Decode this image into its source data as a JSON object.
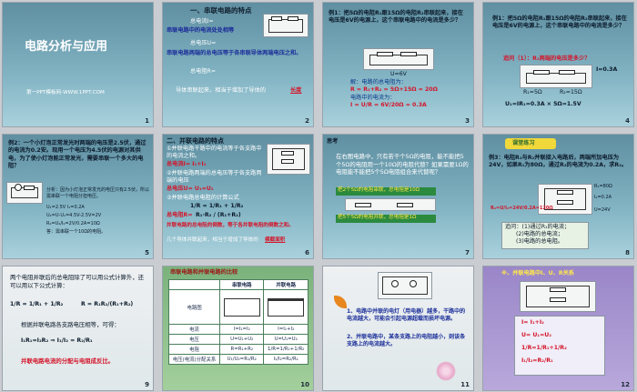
{
  "slides": [
    {
      "num": "1",
      "title": "电路分析与应用",
      "footer": "第一PPT模板网-WWW.1PPT.COM"
    },
    {
      "num": "2",
      "heading": "一、串联电路的特点",
      "l1": "总电流I=",
      "l2": "串联电路中的电流处处相等",
      "l3": "总电压U=",
      "l4": "串联电路两端的总电压等于各串联导体两端电压之和。",
      "l5": "总电阻R=",
      "l6": "导体串联起来，相当于增加了导体的",
      "l6b": "长度"
    },
    {
      "num": "3",
      "q": "例1：把5Ω的电阻R₁跟15Ω的电阻R₂串联起来，接在电压是6V的电源上，这个串联电路中的电流是多少？",
      "v": "U=6V",
      "a1": "解：电路的总电阻为：",
      "a2": "R = R₁+R₂ = 5Ω+15Ω = 20Ω",
      "a3": "电路中的电流为：",
      "a4": "I = U/R = 6V/20Ω = 0.3A"
    },
    {
      "num": "4",
      "q": "例1：把5Ω的电阻R₁跟15Ω的电阻R₂串联起来，接在电压是6V的电源上，这个串联电路中的电流是多少？",
      "ask": "追问（1）：R₁两端的电压是多少？",
      "i": "I=0.3A",
      "r1": "R₁=5Ω",
      "r2": "R₂=15Ω",
      "ans": "U₁=IR₁=0.3A × 5Ω=1.5V"
    },
    {
      "num": "5",
      "q": "例2：一个小灯泡正常发光时两端的电压是2.5伏，通过的电流为0.2安。现用一个电压为4.5伏的电源对其供电，为了使小灯泡能正常发光，需要串联一个多大的电阻？",
      "s1": "分析：因为小灯泡正常发光的电压只有2.5伏，所以需串联一个电阻分担电压。",
      "s2": "U₁=2.5V  I₁=0.2A",
      "s3": "U₂=U-U₁=4.5V-2.5V=2V",
      "s4": "R₂=U₂/I₂=2V/0.2A=10Ω",
      "s5": "答：需串联一个10Ω的电阻。"
    },
    {
      "num": "6",
      "heading": "二、并联电路的特点",
      "p1": "①并联电路干路中的电流等于各支路中的电流之和。",
      "p1b": "总电流I= I₁+I₂",
      "p2": "②并联电路两端的总电压等于各支路两端的电压",
      "p2b": "总电压U= U₁=U₂",
      "p3": "③并联电路总电阻的计算公式",
      "f1": "1/R = 1/R₁ + 1/R₂",
      "p3b": "总电阻R=",
      "f2": "R₁·R₂ / (R₁+R₂)",
      "p4": "并联电路的总电阻的倒数，等于各并联电阻的倒数之和。",
      "p5": "几个导体并联起来，相当于增加了导体的",
      "p5b": "横截面积"
    },
    {
      "num": "7",
      "tag": "思考",
      "q": "在右图电路中，只有若干个5Ω的电阻，能不能把5个5Ω的电阻用一个10Ω的电阻代替？如果需要1Ω的电阻能不能把5个5Ω电阻组合来代替呢？",
      "a1": "把2个5Ω的电阻串联，总电阻是10Ω",
      "a2": "把5个5Ω的电阻并联，总电阻是1Ω"
    },
    {
      "num": "8",
      "badge": "课堂练习",
      "q": "例3：电阻R₁与R₂并联接入电路后，两端所加电压为24V，如果R₁为80Ω，通过R₂的电流为0.2A，求R₂。",
      "m1": "R₁=80Ω",
      "m2": "I₂=0.2A",
      "m3": "U=24V",
      "s": "R₂=U/I₂=24V/0.2A=120Ω",
      "k1": "追问：(1)通过R₁的电流；",
      "k2": "(2)电路的总电流；",
      "k3": "(3)电路的总电阻。"
    },
    {
      "num": "9",
      "l1": "两个电阻并联后的总电阻除了可以用公式计算外，还可以用以下公式计算：",
      "f1": "1/R = 1/R₁ + 1/R₂",
      "f2": "R = R₁R₂/(R₁+R₂)",
      "l2": "根据并联电路各支路电压相等，可得：",
      "f3": "I₁R₁=I₂R₂ ⇒ I₁/I₂ = R₂/R₁",
      "l3": "并联电路电流的分配与电阻成反比。"
    },
    {
      "num": "10",
      "title": "串联电路和并联电路的比较",
      "head": [
        "",
        "串联电路",
        "并联电路"
      ],
      "rows": [
        [
          "电路图",
          "",
          ""
        ],
        [
          "电流",
          "I=I₁=I₂",
          "I=I₁+I₂"
        ],
        [
          "电压",
          "U=U₁+U₂",
          "U=U₁=U₂"
        ],
        [
          "电阻",
          "R=R₁+R₂",
          "1/R=1/R₁+1/R₂"
        ],
        [
          "电压(电流)分配关系",
          "U₁/U₂=R₁/R₂",
          "I₁/I₂=R₂/R₁"
        ]
      ]
    },
    {
      "num": "11",
      "l1": "1、电路中并联的电灯（用电器）越多，干路中的电流越大，可能会引起电源超载而损坏电源。",
      "l2": "2、并联电路中，某条支路上的电阻越小，则该条支路上的电流越大。"
    },
    {
      "num": "12",
      "title": "※、并联电路中I、U、R关系",
      "items": [
        "I= I₁+I₂",
        "U= U₁=U₂",
        "1/R=1/R₁+1/R₂",
        "I₁/I₂=R₂/R₁"
      ]
    }
  ]
}
